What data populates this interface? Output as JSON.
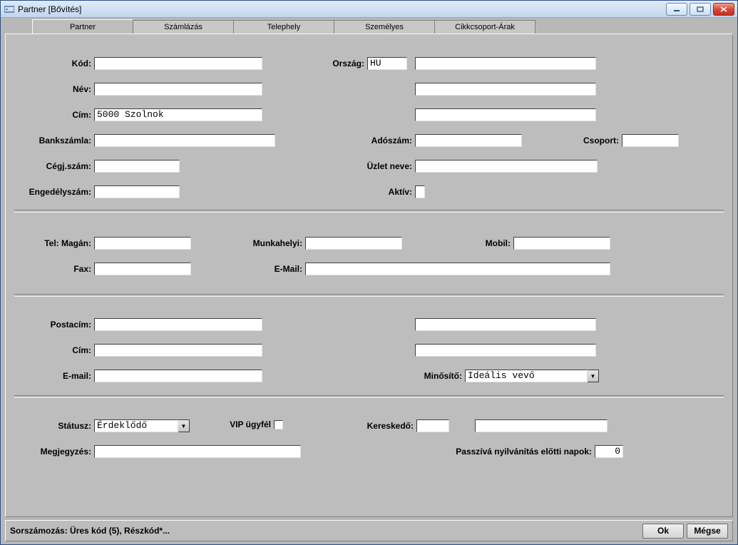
{
  "window": {
    "title": "Partner [Bővítés]"
  },
  "tabs": {
    "t0": "Partner",
    "t1": "Számlázás",
    "t2": "Telephely",
    "t3": "Személyes",
    "t4": "Cikkcsoport-Árak"
  },
  "labels": {
    "kod": "Kód:",
    "orszag": "Ország:",
    "nev": "Név:",
    "cim": "Cím:",
    "bankszamla": "Bankszámla:",
    "adoszam": "Adószám:",
    "csoport": "Csoport:",
    "cegjszam": "Cégj.szám:",
    "uzletneve": "Üzlet neve:",
    "engedelyszam": "Engedélyszám:",
    "aktiv": "Aktív:",
    "telmagan": "Tel: Magán:",
    "munkahelyi": "Munkahelyi:",
    "mobil": "Mobil:",
    "fax": "Fax:",
    "email": "E-Mail:",
    "postacim": "Postacím:",
    "cim2": "Cím:",
    "email2": "E-mail:",
    "minosito": "Minősítő:",
    "statusz": "Státusz:",
    "vip": "VIP ügyfél",
    "kereskedo": "Kereskedő:",
    "megjegyzes": "Megjegyzés:",
    "passziva": "Passzívá nyilvánítás előtti napok:"
  },
  "values": {
    "kod": "",
    "orszag": "HU",
    "orszag_long": "",
    "nev": "",
    "nev2": "",
    "cim": "5000 Szolnok",
    "cim_b": "",
    "bankszamla": "",
    "adoszam": "",
    "csoport": "",
    "cegjszam": "",
    "uzletneve": "",
    "engedelyszam": "",
    "telmagan": "",
    "munkahelyi": "",
    "mobil": "",
    "fax": "",
    "email": "",
    "postacim": "",
    "postacim_b": "",
    "cim2": "",
    "cim2_b": "",
    "email2": "",
    "minosito": "Ideális vevő",
    "statusz": "Érdeklődő",
    "kereskedo_a": "",
    "kereskedo_b": "",
    "megjegyzes": "",
    "passziva": "0"
  },
  "footer": {
    "status": "Sorszámozás: Üres kód (5), Részkód*...",
    "ok": "Ok",
    "cancel": "Mégse"
  }
}
